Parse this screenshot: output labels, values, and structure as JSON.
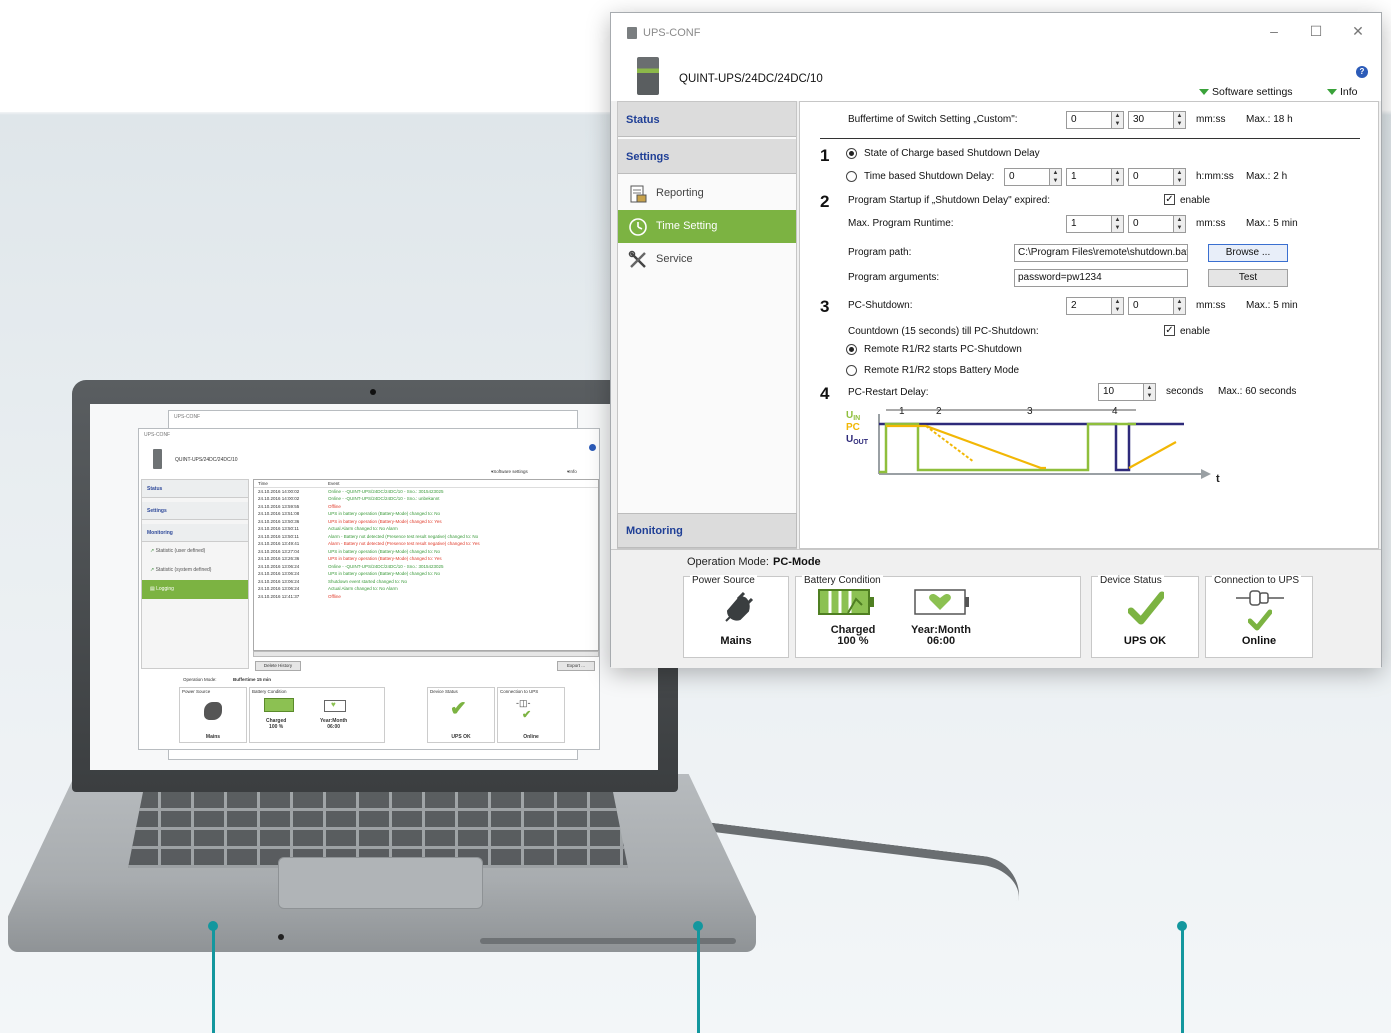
{
  "main_window": {
    "title": "UPS-CONF",
    "device_name": "QUINT-UPS/24DC/24DC/10",
    "help_label": "?",
    "links": {
      "software_settings": "Software settings",
      "info": "Info"
    },
    "controls": {
      "minimize": "–",
      "maximize": "☐",
      "close": "✕"
    },
    "sidebar": {
      "status": "Status",
      "settings": "Settings",
      "items": [
        {
          "label": "Reporting",
          "icon": "report-icon"
        },
        {
          "label": "Time Setting",
          "icon": "clock-icon"
        },
        {
          "label": "Service",
          "icon": "tools-icon"
        }
      ],
      "monitoring": "Monitoring"
    },
    "settings": {
      "buffertime_label": "Buffertime of Switch Setting „Custom\":",
      "buffertime_min": "0",
      "buffertime_sec": "30",
      "buffertime_unit": "mm:ss",
      "buffertime_max": "Max.: 18 h",
      "section1_num": "1",
      "soc_label": "State of Charge based Shutdown Delay",
      "time_based_label": "Time based Shutdown Delay:",
      "tbs_h": "0",
      "tbs_m": "1",
      "tbs_s": "0",
      "tbs_unit": "h:mm:ss",
      "tbs_max": "Max.: 2 h",
      "section2_num": "2",
      "program_startup_label": "Program Startup if „Shutdown Delay\" expired:",
      "program_startup_enable": "enable",
      "max_runtime_label": "Max. Program Runtime:",
      "max_runtime_min": "1",
      "max_runtime_sec": "0",
      "max_runtime_unit": "mm:ss",
      "max_runtime_max": "Max.: 5 min",
      "program_path_label": "Program path:",
      "program_path_value": "C:\\Program Files\\remote\\shutdown.bat",
      "browse_button": "Browse ...",
      "program_args_label": "Program arguments:",
      "program_args_value": "password=pw1234",
      "test_button": "Test",
      "section3_num": "3",
      "pc_shutdown_label": "PC-Shutdown:",
      "pc_shutdown_min": "2",
      "pc_shutdown_sec": "0",
      "pc_shutdown_unit": "mm:ss",
      "pc_shutdown_max": "Max.: 5 min",
      "countdown_label": "Countdown (15 seconds) till PC-Shutdown:",
      "countdown_enable": "enable",
      "remote_starts_label": "Remote R1/R2 starts PC-Shutdown",
      "remote_stops_label": "Remote R1/R2 stops Battery Mode",
      "section4_num": "4",
      "pc_restart_label": "PC-Restart Delay:",
      "pc_restart_value": "10",
      "pc_restart_unit": "seconds",
      "pc_restart_max": "Max.: 60 seconds"
    },
    "diagram": {
      "labels": {
        "uin": "UIN",
        "pc": "PC",
        "uout": "UOUT",
        "t": "t"
      },
      "markers": [
        "1",
        "2",
        "3",
        "4"
      ],
      "colors": {
        "uin": "#8fbf3c",
        "pc": "#f2b705",
        "uout": "#2e2a7a"
      }
    },
    "status_bar": {
      "operation_mode_label": "Operation Mode:",
      "operation_mode_value": "PC-Mode",
      "power_source_title": "Power Source",
      "power_source_value": "Mains",
      "battery_title": "Battery Condition",
      "battery_charged": "Charged",
      "battery_percent": "100 %",
      "battery_ym_label": "Year:Month",
      "battery_ym_value": "06:00",
      "device_status_title": "Device Status",
      "device_status_value": "UPS OK",
      "connection_title": "Connection to UPS",
      "connection_value": "Online"
    }
  },
  "laptop_window": {
    "outer_title": "UPS-CONF",
    "title": "UPS-CONF",
    "device_name": "QUINT-UPS/24DC/24DC/10",
    "links": {
      "software_settings": "Software settings",
      "info": "Info"
    },
    "sidebar": {
      "status": "Status",
      "settings": "Settings",
      "monitoring": "Monitoring",
      "items": [
        "Statistic (user defined)",
        "Statistic (system defined)",
        "Logging"
      ]
    },
    "log_headers": {
      "time": "Time",
      "event": "Event"
    },
    "log_rows": [
      {
        "time": "24.10.2016 14:00:02",
        "event": "Online - -QUINT-UPS/24DC/24DC/10 - Sno.: 3015423025",
        "color": "#3a9a3a"
      },
      {
        "time": "24.10.2016 14:00:02",
        "event": "Online - -QUINT-UPS/24DC/24DC/10 - Sno.: unbekannt",
        "color": "#3a9a3a"
      },
      {
        "time": "24.10.2016 13:59:55",
        "event": "Offline",
        "color": "#e03a2a"
      },
      {
        "time": "24.10.2016 13:51:08",
        "event": "UPS in battery operation (Battery-Mode) changed to: No",
        "color": "#3a9a3a"
      },
      {
        "time": "24.10.2016 13:50:36",
        "event": "UPS in battery operation (Battery-Mode) changed to: Yes",
        "color": "#e03a2a"
      },
      {
        "time": "24.10.2016 13:50:11",
        "event": "Actual Alarm changed to: No Alarm",
        "color": "#3a9a3a"
      },
      {
        "time": "24.10.2016 13:50:11",
        "event": "Alarm - Battery not detected (Presence test result negative) changed to: No",
        "color": "#3a9a3a"
      },
      {
        "time": "24.10.2016 13:49:41",
        "event": "Alarm - Battery not detected (Presence test result negative) changed to: Yes",
        "color": "#e03a2a"
      },
      {
        "time": "24.10.2016 13:27:04",
        "event": "UPS in battery operation (Battery-Mode) changed to: No",
        "color": "#3a9a3a"
      },
      {
        "time": "24.10.2016 13:26:36",
        "event": "UPS in battery operation (Battery-Mode) changed to: Yes",
        "color": "#e03a2a"
      },
      {
        "time": "24.10.2016 13:06:24",
        "event": "Online - -QUINT-UPS/24DC/24DC/10 - Sno.: 3015423025",
        "color": "#3a9a3a"
      },
      {
        "time": "24.10.2016 13:06:24",
        "event": "UPS in battery operation (Battery-Mode) changed to: No",
        "color": "#3a9a3a"
      },
      {
        "time": "24.10.2016 13:06:24",
        "event": "Shutdown event started changed to: No",
        "color": "#3a9a3a"
      },
      {
        "time": "24.10.2016 13:06:24",
        "event": "Actual Alarm changed to: No Alarm",
        "color": "#3a9a3a"
      },
      {
        "time": "24.10.2016 12:41:37",
        "event": "Offline",
        "color": "#e03a2a"
      }
    ],
    "delete_history_button": "Delete History",
    "export_button": "Export ...",
    "operation_mode_label": "Operation Mode:",
    "operation_mode_value": "Buffertime 15 min",
    "status": {
      "power_source_title": "Power Source",
      "power_source_value": "Mains",
      "battery_title": "Battery Condition",
      "battery_charged": "Charged",
      "battery_percent": "100 %",
      "battery_ym_label": "Year:Month",
      "battery_ym_value": "06:00",
      "device_status_title": "Device Status",
      "device_status_value": "UPS OK",
      "connection_title": "Connection to UPS",
      "connection_value": "Online"
    },
    "back_window_status": {
      "charged": "Charged",
      "ym_label": "Year:Month",
      "mains": "Mains",
      "percent": "100 %",
      "ym_value": "06:00",
      "ups_ok": "UPS OK",
      "online": "Online"
    }
  },
  "colors": {
    "accent_green": "#7cb342",
    "link_blue": "#1f3f96",
    "callout_teal": "#13979e"
  }
}
